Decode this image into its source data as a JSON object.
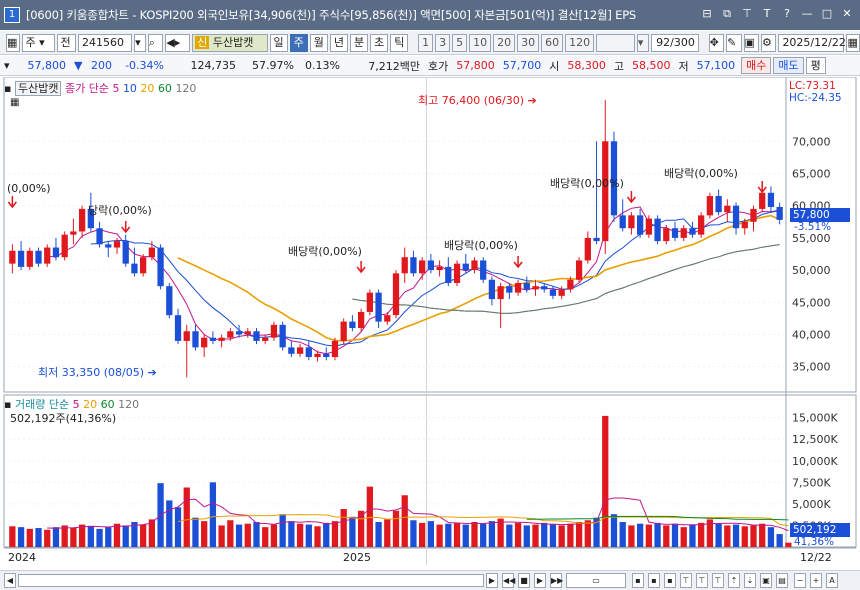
{
  "window": {
    "number": "1",
    "title": "[0600] 키움종합차트 - KOSPI200 외국인보유[34,906(천)] 주식수[95,856(천)] 액면[500] 자본금[501(억)] 결산[12월] EPS",
    "controls": [
      "⊟",
      "⧉",
      "⊤",
      "T",
      "?",
      "—",
      "□",
      "✕"
    ]
  },
  "toolbar": {
    "period_select": "주",
    "prev": "전",
    "code": "241560",
    "stock_badge": "신",
    "stock_name": "두산밥캣",
    "periods": [
      "일",
      "주",
      "월",
      "년",
      "분",
      "초",
      "틱"
    ],
    "active_period": "주",
    "intervals": [
      "1",
      "3",
      "5",
      "10",
      "20",
      "30",
      "60",
      "120"
    ],
    "count": "92/300",
    "date": "2025/12/22"
  },
  "quote": {
    "price": "57,800",
    "change": "200",
    "change_pct": "-0.34%",
    "volume": "124,735",
    "rate1": "57.97%",
    "rate2": "0.13%",
    "amount": "7,212백만",
    "ask_label": "호가",
    "ask": "57,800",
    "bid": "57,700",
    "open_label": "시",
    "open": "58,300",
    "high_label": "고",
    "high": "58,500",
    "low_label": "저",
    "low": "57,100",
    "buy_button": "매수",
    "sell_button": "매도",
    "eval_button": "평"
  },
  "price_panel": {
    "stock_tag": "두산밥캣",
    "legend": [
      {
        "label": "종가 단순",
        "color": "#c0168a"
      },
      {
        "label": "5",
        "color": "#c0168a"
      },
      {
        "label": "10",
        "color": "#1a4fd6"
      },
      {
        "label": "20",
        "color": "#e8a000"
      },
      {
        "label": "60",
        "color": "#0a8a2a"
      },
      {
        "label": "120",
        "color": "#777777"
      }
    ],
    "lc": "LC:73.31",
    "hc": "HC:-24.35",
    "current_price": "57,800",
    "current_pct": "-3.51%",
    "high_note": "최고 76,400 (06/30)",
    "low_note": "최저 33,350 (08/05)",
    "dividend_notes": [
      "(0,00%)",
      "당락(0,00%)",
      "배당락(0,00%)",
      "배당락(0,00%)",
      "배당락(0,00%)",
      "배당락(0,00%)"
    ]
  },
  "volume_panel": {
    "legend": [
      {
        "label": "거래량 단순",
        "color": "#1a8a9a"
      },
      {
        "label": "5",
        "color": "#c0168a"
      },
      {
        "label": "20",
        "color": "#e8a000"
      },
      {
        "label": "60",
        "color": "#0a8a2a"
      },
      {
        "label": "120",
        "color": "#777777"
      }
    ],
    "last_volume": "502,192주(41,36%)",
    "last_volume_box": "502,192",
    "last_pct": "41,36%"
  },
  "x_axis": {
    "labels": [
      "2024",
      "2025"
    ],
    "end_label": "12/22"
  },
  "chart_data": [
    {
      "type": "candlestick",
      "title": "두산밥캣",
      "ylim": [
        30000,
        80000
      ],
      "yticks": [
        "35,000",
        "40,000",
        "45,000",
        "50,000",
        "55,000",
        "60,000",
        "65,000",
        "70,000"
      ],
      "candles": [
        [
          51000,
          54000,
          49500,
          53000
        ],
        [
          53000,
          54500,
          50000,
          50500
        ],
        [
          50500,
          53500,
          50000,
          53000
        ],
        [
          53000,
          53500,
          50500,
          51000
        ],
        [
          51000,
          54000,
          50500,
          53500
        ],
        [
          53500,
          55000,
          51500,
          52000
        ],
        [
          52000,
          56000,
          51500,
          55500
        ],
        [
          55500,
          58000,
          54000,
          56000
        ],
        [
          56000,
          60000,
          55000,
          59500
        ],
        [
          59500,
          62000,
          56000,
          56500
        ],
        [
          56500,
          57500,
          53500,
          54000
        ],
        [
          54000,
          54500,
          52000,
          53500
        ],
        [
          53500,
          55000,
          52500,
          54500
        ],
        [
          54500,
          55500,
          50500,
          51000
        ],
        [
          51000,
          53500,
          49000,
          49500
        ],
        [
          49500,
          52500,
          49000,
          52000
        ],
        [
          52000,
          54500,
          51500,
          53500
        ],
        [
          53500,
          54000,
          47000,
          47500
        ],
        [
          47500,
          48000,
          42500,
          43000
        ],
        [
          43000,
          44000,
          38500,
          39000
        ],
        [
          39000,
          41500,
          33350,
          40500
        ],
        [
          40500,
          41500,
          37500,
          38000
        ],
        [
          38000,
          40000,
          36500,
          39500
        ],
        [
          39500,
          40500,
          38500,
          39000
        ],
        [
          39000,
          40000,
          38000,
          39500
        ],
        [
          39500,
          41000,
          39000,
          40500
        ],
        [
          40500,
          41500,
          39500,
          40000
        ],
        [
          40000,
          41000,
          39500,
          40500
        ],
        [
          40500,
          41000,
          38500,
          39000
        ],
        [
          39000,
          40000,
          38500,
          39500
        ],
        [
          39500,
          42000,
          39000,
          41500
        ],
        [
          41500,
          42000,
          37500,
          38000
        ],
        [
          38000,
          39000,
          36500,
          37000
        ],
        [
          37000,
          38500,
          36500,
          38000
        ],
        [
          38000,
          39000,
          36000,
          36500
        ],
        [
          36500,
          37500,
          35800,
          37000
        ],
        [
          37000,
          38000,
          36000,
          36500
        ],
        [
          36500,
          39500,
          36000,
          39000
        ],
        [
          39000,
          42500,
          38500,
          42000
        ],
        [
          42000,
          43000,
          40500,
          41000
        ],
        [
          41000,
          44000,
          40500,
          43500
        ],
        [
          43500,
          47000,
          43000,
          46500
        ],
        [
          46500,
          47000,
          41000,
          42000
        ],
        [
          42000,
          43500,
          41500,
          43000
        ],
        [
          43000,
          50000,
          42500,
          49500
        ],
        [
          49500,
          53500,
          48000,
          52000
        ],
        [
          52000,
          53000,
          49000,
          49500
        ],
        [
          49500,
          52000,
          48500,
          51500
        ],
        [
          51500,
          52500,
          49500,
          50000
        ],
        [
          50000,
          51500,
          49000,
          50500
        ],
        [
          50500,
          52000,
          47500,
          48000
        ],
        [
          48000,
          51500,
          47500,
          51000
        ],
        [
          51000,
          52500,
          49500,
          50000
        ],
        [
          50000,
          52000,
          49500,
          51500
        ],
        [
          51500,
          52000,
          48000,
          48500
        ],
        [
          48500,
          49000,
          44500,
          45500
        ],
        [
          45500,
          48000,
          41000,
          47500
        ],
        [
          47500,
          48000,
          45500,
          46500
        ],
        [
          46500,
          48500,
          46000,
          48000
        ],
        [
          48000,
          49000,
          46500,
          47000
        ],
        [
          47000,
          48500,
          46000,
          47500
        ],
        [
          47500,
          48000,
          46500,
          47000
        ],
        [
          47000,
          47500,
          45500,
          46000
        ],
        [
          46000,
          47500,
          45500,
          47000
        ],
        [
          47000,
          49000,
          46500,
          48500
        ],
        [
          48500,
          52000,
          48000,
          51500
        ],
        [
          51500,
          56000,
          51000,
          55000
        ],
        [
          55000,
          70000,
          54000,
          54500
        ],
        [
          54500,
          76400,
          52500,
          70000
        ],
        [
          70000,
          71500,
          57500,
          58500
        ],
        [
          58500,
          61000,
          56000,
          56500
        ],
        [
          56500,
          59000,
          55500,
          58500
        ],
        [
          58500,
          59500,
          55000,
          55500
        ],
        [
          55500,
          58500,
          55000,
          58000
        ],
        [
          58000,
          58500,
          54000,
          54500
        ],
        [
          54500,
          57000,
          54000,
          56500
        ],
        [
          56500,
          57500,
          54500,
          55000
        ],
        [
          55000,
          57000,
          54500,
          56500
        ],
        [
          56500,
          57500,
          55000,
          55500
        ],
        [
          55500,
          59000,
          55000,
          58500
        ],
        [
          58500,
          62000,
          58000,
          61500
        ],
        [
          61500,
          62500,
          58500,
          59000
        ],
        [
          59000,
          61000,
          57500,
          60000
        ],
        [
          60000,
          60500,
          55500,
          56500
        ],
        [
          56500,
          58000,
          55500,
          57500
        ],
        [
          57500,
          60000,
          56000,
          59500
        ],
        [
          59500,
          62500,
          59000,
          62000
        ],
        [
          62000,
          63000,
          59000,
          59800
        ],
        [
          59800,
          60500,
          57100,
          57800
        ]
      ]
    },
    {
      "type": "bar",
      "title": "거래량",
      "ylim": [
        0,
        16000000
      ],
      "yticks": [
        "2,500K",
        "5,000K",
        "7,500K",
        "10,000K",
        "12,500K",
        "15,000K"
      ],
      "values": [
        2400000,
        2300000,
        2100000,
        2200000,
        2000000,
        2300000,
        2500000,
        2200000,
        2600000,
        2400000,
        2100000,
        2300000,
        2700000,
        2500000,
        2900000,
        2600000,
        3200000,
        7400000,
        5400000,
        4600000,
        6900000,
        3400000,
        3000000,
        7500000,
        2500000,
        3100000,
        2600000,
        2700000,
        2900000,
        2300000,
        2600000,
        3800000,
        3000000,
        2700000,
        2600000,
        2400000,
        2800000,
        3000000,
        4400000,
        3500000,
        4200000,
        7000000,
        2900000,
        3200000,
        4200000,
        6000000,
        3100000,
        2800000,
        3000000,
        2600000,
        2700000,
        2800000,
        2600000,
        2900000,
        2700000,
        3000000,
        3300000,
        2600000,
        2800000,
        2500000,
        2600000,
        2800000,
        2600000,
        2500000,
        2700000,
        2900000,
        3100000,
        3400000,
        15200000,
        3800000,
        2900000,
        2500000,
        2700000,
        2600000,
        2800000,
        2500000,
        2700000,
        2300000,
        2600000,
        2800000,
        3200000,
        2700000,
        2500000,
        2600000,
        2400000,
        2500000,
        2700000,
        2300000,
        1500000,
        502192
      ],
      "colors": "up=red, down=blue"
    }
  ]
}
